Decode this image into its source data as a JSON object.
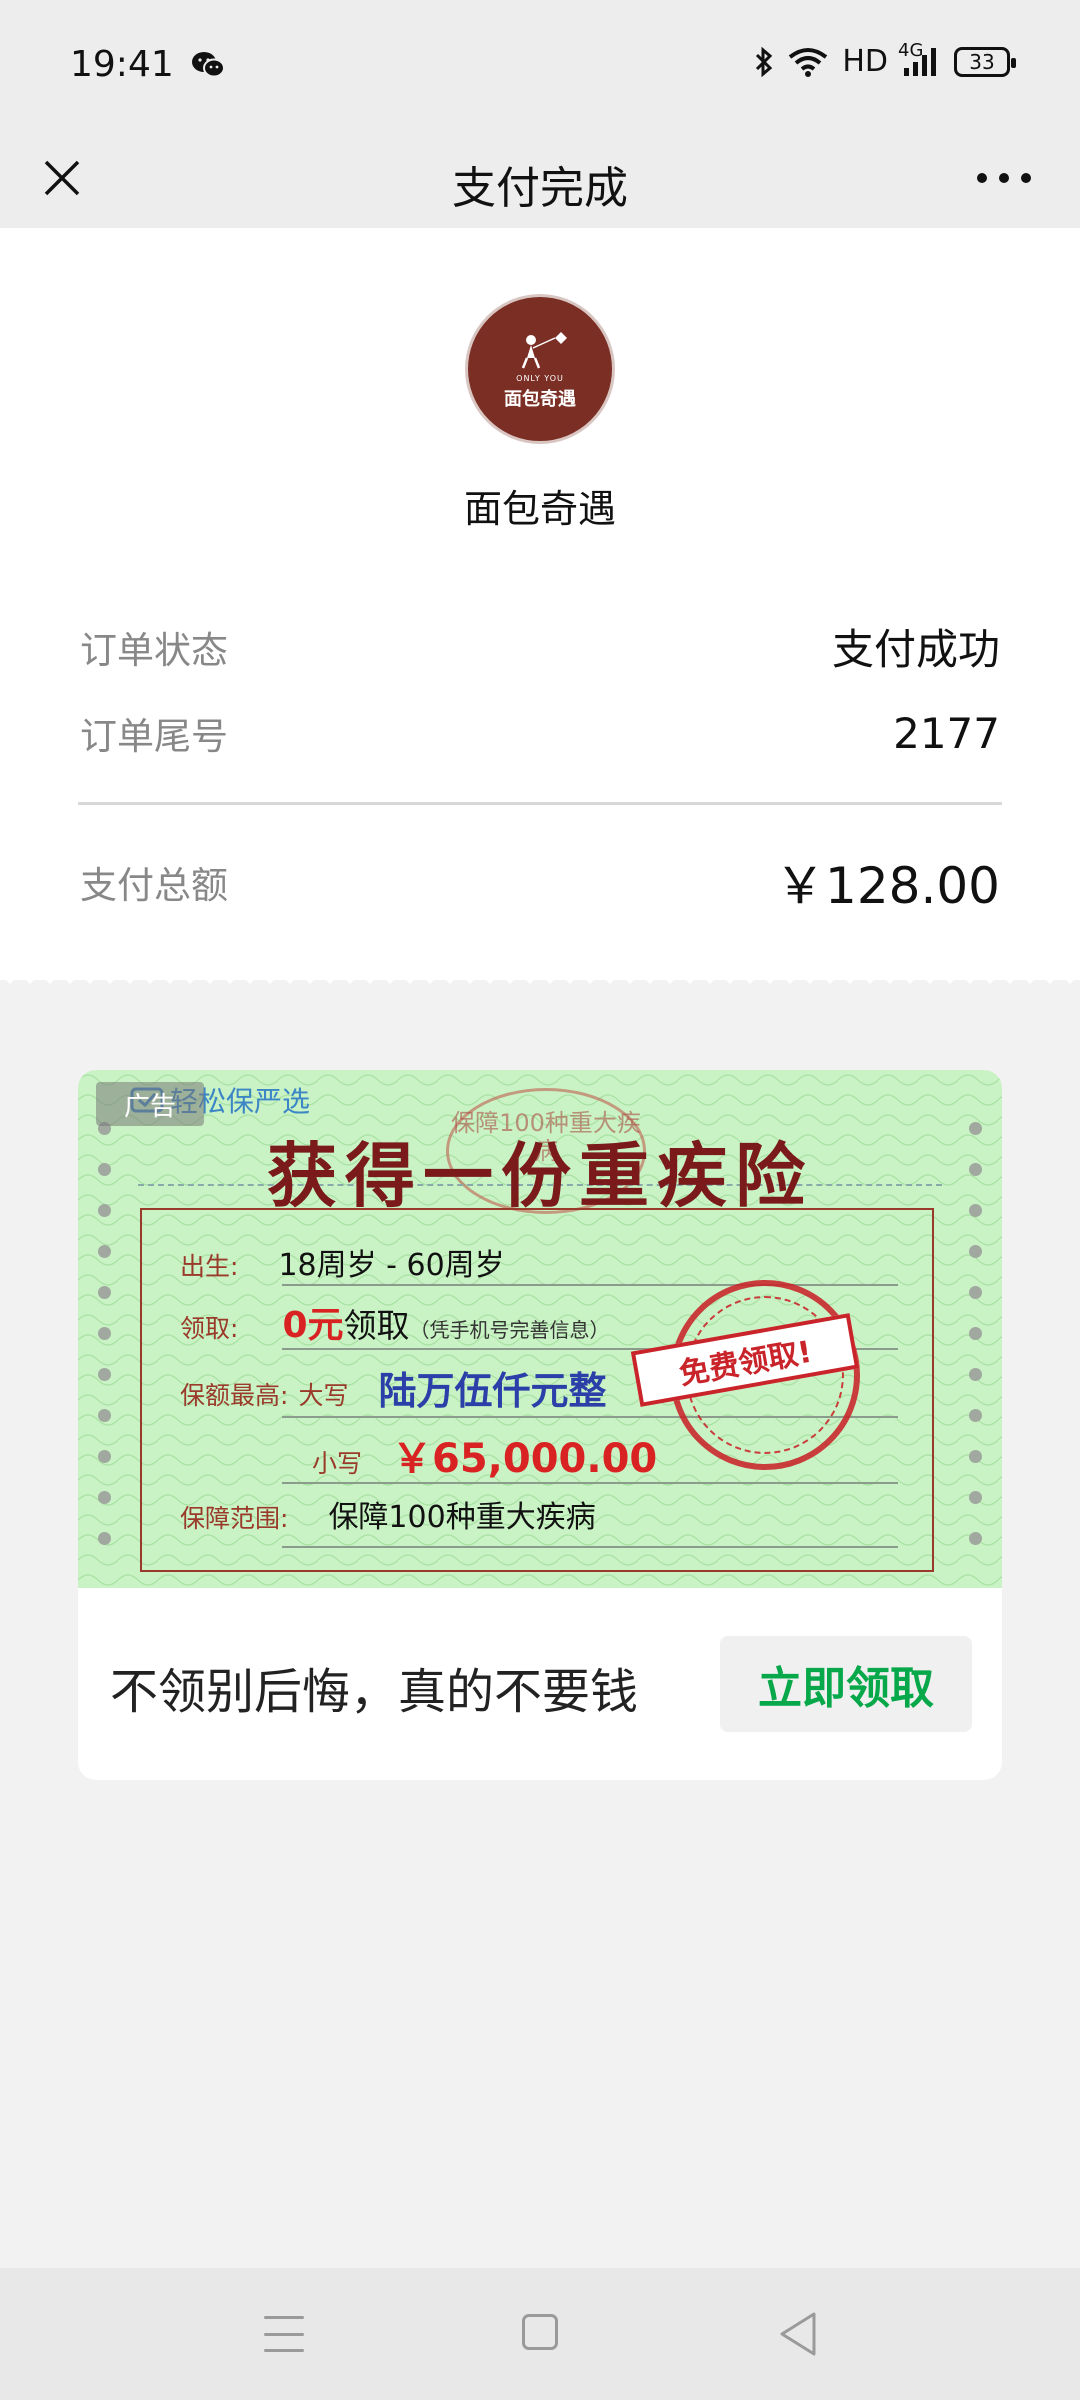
{
  "status_bar": {
    "time": "19:41",
    "network": "HD",
    "signal_type": "4G",
    "battery": "33",
    "icons": [
      "wechat-icon",
      "bluetooth-icon",
      "wifi-icon",
      "signal-icon",
      "battery-icon"
    ]
  },
  "nav": {
    "title": "支付完成",
    "close_icon": "close-icon",
    "more_icon": "more-icon"
  },
  "merchant": {
    "logo_small_text": "ONLY YOU",
    "logo_name": "面包奇遇",
    "name": "面包奇遇"
  },
  "order": {
    "rows": [
      {
        "label": "订单状态",
        "value": "支付成功"
      },
      {
        "label": "订单尾号",
        "value": "2177"
      }
    ],
    "total_label": "支付总额",
    "total_value": "￥128.00"
  },
  "ad": {
    "tag": "广告",
    "brand": "轻松保严选",
    "faded_stamp": "保障100种重大疾病",
    "headline": "获得一份重疾险",
    "fields": {
      "birth_label": "出生:",
      "birth_value": "18周岁 - 60周岁",
      "claim_label": "领取:",
      "claim_price": "0元",
      "claim_text": "领取",
      "claim_note": "（凭手机号完善信息）",
      "coverage_label": "保额最高:",
      "upper_label": "大写",
      "upper_value": "陆万伍仟元整",
      "lower_label": "小写",
      "lower_value": "￥65,000.00",
      "scope_label": "保障范围:",
      "scope_value": "保障100种重大疾病"
    },
    "stamp_text": "免费领取!",
    "slogan": "不领别后悔，真的不要钱",
    "button": "立即领取",
    "colors": {
      "button_text": "#07a84a",
      "headline": "#7a1a1a",
      "stamp": "#c9242a",
      "banner": "#c9f3c4"
    }
  },
  "system_nav": {
    "icons": [
      "menu-icon",
      "home-icon",
      "back-icon"
    ]
  }
}
